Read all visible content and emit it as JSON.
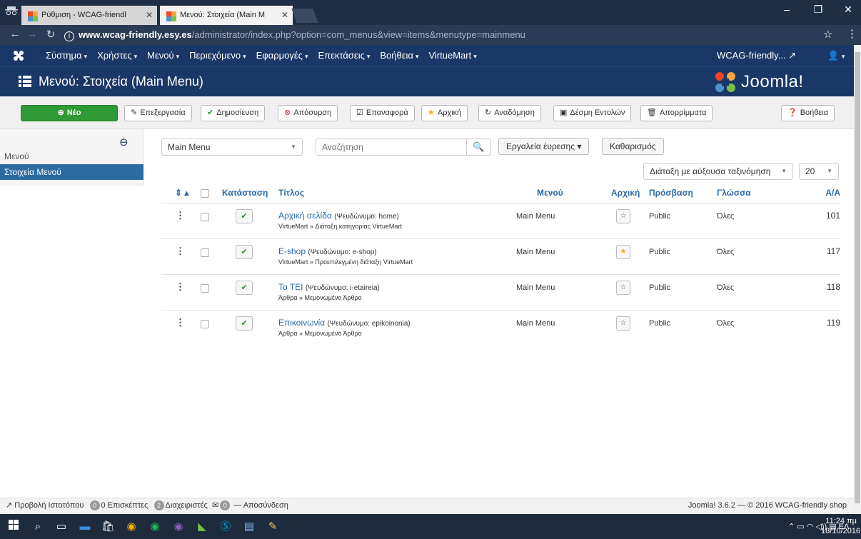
{
  "browser": {
    "tabs": [
      {
        "label": "Ρύθμιση - WCAG-friendl"
      },
      {
        "label": "Μενού: Στοιχεία (Main M"
      }
    ],
    "url_host": "www.wcag-friendly.esy.es",
    "url_path": "/administrator/index.php?option=com_menus&view=items&menutype=mainmenu"
  },
  "topnav": {
    "items": [
      "Σύστημα",
      "Χρήστες",
      "Μενού",
      "Περιεχόμενο",
      "Εφαρμογές",
      "Επεκτάσεις",
      "Βοήθεια",
      "VirtueMart"
    ],
    "site_name": "WCAG-friendly..."
  },
  "page": {
    "title": "Μενού: Στοιχεία (Main Menu)",
    "brand": "Joomla!"
  },
  "toolbar": {
    "new": "Νέο",
    "edit": "Επεξεργασία",
    "publish": "Δημοσίευση",
    "unpublish": "Απόσυρση",
    "checkin": "Επαναφορά",
    "home": "Αρχική",
    "rebuild": "Αναδόμηση",
    "batch": "Δέσμη Εντολών",
    "trash": "Απορρίμματα",
    "help": "Βοήθεια"
  },
  "sidebar": {
    "items": [
      {
        "label": "Μενού"
      },
      {
        "label": "Στοιχεία Μενού"
      }
    ]
  },
  "filters": {
    "menu_select": "Main Menu",
    "search_placeholder": "Αναζήτηση",
    "search_tools": "Εργαλεία έυρεσης",
    "clear": "Καθαρισμός",
    "ordering": "Διάταξη με αύξουσα ταξινόμηση",
    "limit": "20"
  },
  "table": {
    "headers": {
      "state": "Κατάσταση",
      "title": "Τίτλος",
      "menu": "Μενού",
      "home": "Αρχική",
      "access": "Πρόσβαση",
      "language": "Γλώσσα",
      "id": "Α/Α"
    },
    "rows": [
      {
        "title": "Αρχική σελίδα",
        "alias": "(Ψευδώνυμο: home)",
        "type": "VirtueMart » Διάταξη κατηγορίας VirtueMart",
        "menu": "Main Menu",
        "home": false,
        "access": "Public",
        "language": "Όλες",
        "id": "101"
      },
      {
        "title": "E-shop",
        "alias": "(Ψευδώνυμο: e-shop)",
        "type": "VirtueMart » Προεπιλεγμένη διάταξη VirtueMart",
        "menu": "Main Menu",
        "home": true,
        "access": "Public",
        "language": "Όλες",
        "id": "117"
      },
      {
        "title": "Το ΤΕΙ",
        "alias": "(Ψευδώνυμο: i-etaireia)",
        "type": "Άρθρα » Μεμονωμένο Άρθρο",
        "menu": "Main Menu",
        "home": false,
        "access": "Public",
        "language": "Όλες",
        "id": "118"
      },
      {
        "title": "Επικοινωνία",
        "alias": "(Ψευδώνυμο: epikoinonia)",
        "type": "Άρθρα » Μεμονωμένο Άρθρο",
        "menu": "Main Menu",
        "home": false,
        "access": "Public",
        "language": "Όλες",
        "id": "119"
      }
    ]
  },
  "status": {
    "view_site": "Προβολή Ιστοτόπου",
    "visitors_count": "0",
    "visitors_label": "0 Επισκέπτες",
    "admins_count": "2",
    "admins_label": "Διαχειριστές",
    "messages_count": "0",
    "logout": "Αποσύνδεση",
    "footer": "Joomla! 3.6.2 — © 2016 WCAG-friendly shop"
  },
  "taskbar": {
    "lang": "ΕΛ",
    "time": "11:24 πμ",
    "date": "18/10/2016"
  },
  "colors": {
    "nav": "#1a3867",
    "accent": "#2b6aa7",
    "new_button": "#2f9a35"
  }
}
